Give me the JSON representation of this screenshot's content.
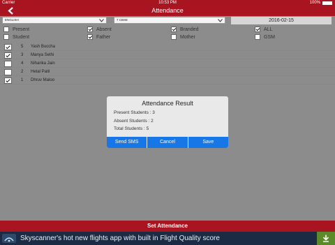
{
  "status_bar": {
    "carrier": "Carrier",
    "time": "10:53 PM",
    "battery": "100%"
  },
  "nav": {
    "title": "Attendance"
  },
  "selectors": {
    "medium": "ENGLISH",
    "class": "7 CBSE",
    "date": "2016-02-15"
  },
  "options": {
    "present": "Present",
    "absent": "Absent",
    "branded": "Branded",
    "all": "ALL",
    "student": "Student",
    "father": "Father",
    "mother": "Mother",
    "gsm": "GSM"
  },
  "students": [
    {
      "roll": "5",
      "name": "Yash Buccha",
      "checked": true
    },
    {
      "roll": "3",
      "name": "Manya Sethi",
      "checked": true
    },
    {
      "roll": "4",
      "name": "Niharika Jain",
      "checked": false
    },
    {
      "roll": "2",
      "name": "Hetal Patil",
      "checked": false
    },
    {
      "roll": "1",
      "name": "Dhruv Maloo",
      "checked": true
    }
  ],
  "dialog": {
    "title": "Attendance Result",
    "present": "Present Students : 3",
    "absent": "Absent Students : 2",
    "total": "Total Students : 5",
    "send_sms": "Send SMS",
    "cancel": "Cancel",
    "save": "Save"
  },
  "footer": {
    "set_attendance": "Set Attendance"
  },
  "ad": {
    "text": "Skyscanner's hot new flights app with built in Flight Quality score"
  },
  "colors": {
    "brand_red": "#a8141f",
    "dialog_blue": "#1877e6",
    "overlay_gray": "#8c8c8c"
  }
}
